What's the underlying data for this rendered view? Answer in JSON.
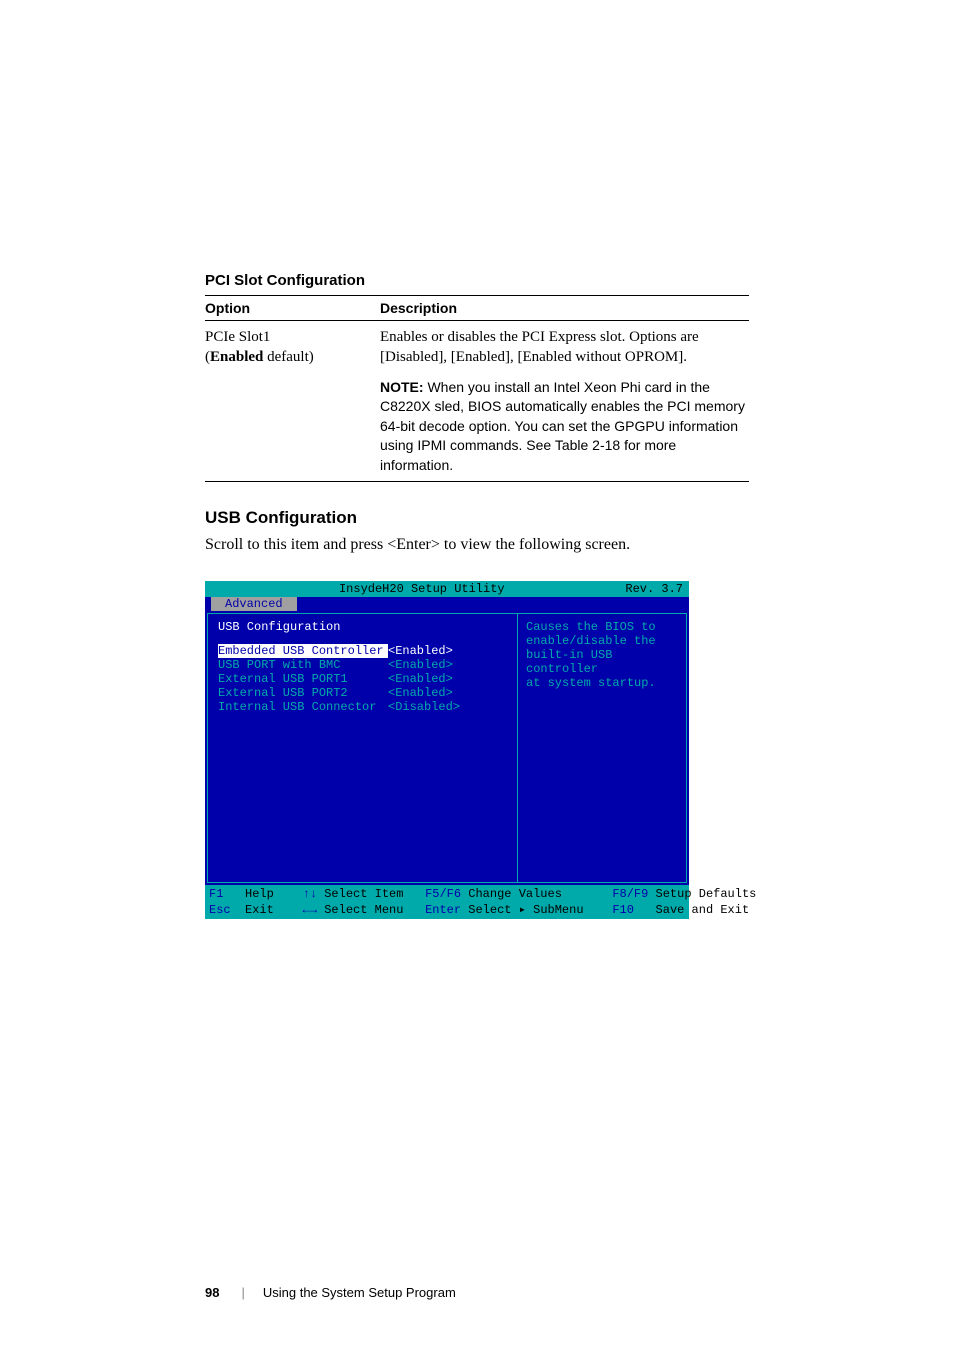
{
  "table": {
    "title": "PCI Slot Configuration",
    "headers": {
      "option": "Option",
      "description": "Description"
    },
    "row1": {
      "option_line1": "PCIe Slot1",
      "option_prefix": "(",
      "option_bold": "Enabled",
      "option_suffix": " default)",
      "desc": "Enables or disables the PCI Express slot. Options are [Disabled], [Enabled], [Enabled without OPROM].",
      "note_label": "NOTE:",
      "note_text": " When you install an Intel Xeon Phi card in the C8220X sled, BIOS automatically enables the PCI memory 64-bit decode option. You can set the GPGPU information using IPMI commands. See Table 2-18 for more information."
    }
  },
  "section": {
    "heading": "USB Configuration",
    "body": "Scroll to this item and press <Enter> to view the following screen."
  },
  "bios": {
    "title_center": "InsydeH20 Setup Utility",
    "title_right": "Rev. 3.7",
    "tab": "Advanced",
    "left_title": "USB Configuration",
    "items": [
      {
        "label": "Embedded USB Controller",
        "value": "<Enabled>",
        "selected": true
      },
      {
        "label": "USB PORT with BMC",
        "value": "<Enabled>",
        "selected": false
      },
      {
        "label": "External USB PORT1",
        "value": "<Enabled>",
        "selected": false
      },
      {
        "label": "External USB PORT2",
        "value": "<Enabled>",
        "selected": false
      },
      {
        "label": "Internal USB Connector",
        "value": "<Disabled>",
        "selected": false
      }
    ],
    "help": {
      "l1": "Causes the BIOS to",
      "l2": "enable/disable the",
      "l3": "built-in USB controller",
      "l4": "at system startup."
    },
    "footer": {
      "r0": {
        "k1": "F1",
        "t1": "   Help    ",
        "k2": "↑↓",
        "t2": " Select Item   ",
        "k3": "F5/F6",
        "t3": " Change Values       ",
        "k4": "F8/F9",
        "t4": " Setup Defaults"
      },
      "r1": {
        "k1": "Esc",
        "t1": "  Exit    ",
        "k2": "←→",
        "t2": " Select Menu   ",
        "k3": "Enter",
        "t3": " Select ▸ SubMenu    ",
        "k4": "F10",
        "t4": "   Save and Exit"
      }
    }
  },
  "footer": {
    "page": "98",
    "divider": "|",
    "chapter": "Using the System Setup Program"
  }
}
